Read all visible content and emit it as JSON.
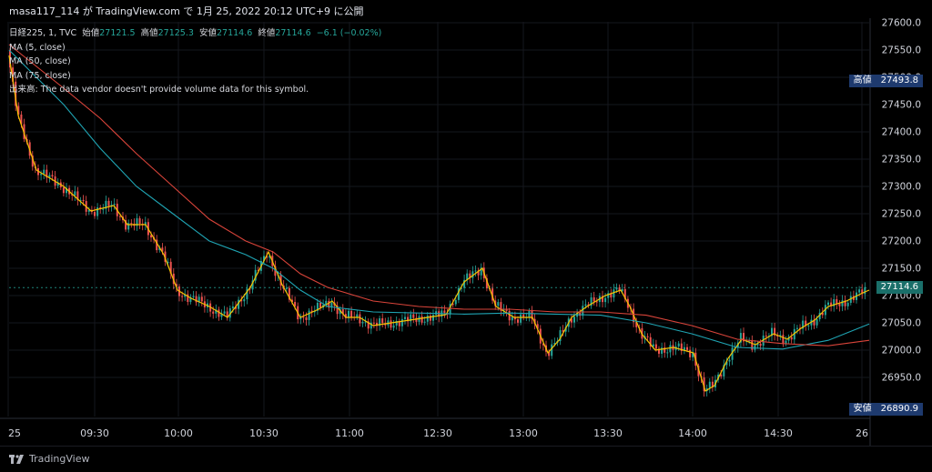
{
  "header": {
    "title": "masa117_114 が TradingView.com で 1月 25, 2022 20:12 UTC+9 に公開"
  },
  "legend": {
    "symbol": "日経225, 1, TVC",
    "open_label": "始値",
    "open_value": "27121.5",
    "high_label": "高値",
    "high_value": "27125.3",
    "low_label": "安値",
    "low_value": "27114.6",
    "close_label": "終値",
    "close_value": "27114.6",
    "change": "−6.1 (−0.02%)",
    "ma1": "MA (5, close)",
    "ma2": "MA (50, close)",
    "ma3": "MA (75, close)",
    "volume": "出来高: The data vendor doesn't provide volume data for this symbol."
  },
  "price_tags": {
    "high_label": "高値",
    "high_value": "27493.8",
    "low_label": "安値",
    "low_value": "26890.9",
    "last_value": "27114.6"
  },
  "footer": {
    "brand": "TradingView"
  },
  "colors": {
    "up": "#26a69a",
    "down": "#ef5350",
    "ma5": "#f5c400",
    "ma50": "#1fa4b3",
    "ma75": "#d9443a",
    "high_tag": "#1e3a6e",
    "low_tag": "#1e3a6e",
    "last_tag": "#1a6f6a"
  },
  "chart_data": {
    "type": "candlestick",
    "ylim": [
      26890,
      27600
    ],
    "yticks": [
      27600.0,
      27550.0,
      27500.0,
      27450.0,
      27400.0,
      27350.0,
      27300.0,
      27250.0,
      27200.0,
      27150.0,
      27100.0,
      27050.0,
      27000.0,
      26950.0
    ],
    "ytick_labels": [
      "27600.0",
      "27550.0",
      "27500.0",
      "27450.0",
      "27400.0",
      "27350.0",
      "27300.0",
      "27250.0",
      "27200.0",
      "27150.0",
      "27100.0",
      "27050.0",
      "27000.0",
      "26950.0"
    ],
    "xticks": [
      "25",
      "09:30",
      "10:00",
      "10:30",
      "11:00",
      "12:30",
      "13:00",
      "13:30",
      "14:00",
      "14:30",
      "26"
    ],
    "last_price": 27114.6,
    "high": 27493.8,
    "low": 26890.9,
    "series": [
      {
        "name": "MA (5, close)",
        "values": [
          [
            0,
            27540
          ],
          [
            10,
            27430
          ],
          [
            30,
            27330
          ],
          [
            60,
            27300
          ],
          [
            90,
            27255
          ],
          [
            115,
            27265
          ],
          [
            130,
            27230
          ],
          [
            150,
            27230
          ],
          [
            170,
            27175
          ],
          [
            185,
            27110
          ],
          [
            200,
            27095
          ],
          [
            220,
            27080
          ],
          [
            240,
            27060
          ],
          [
            265,
            27115
          ],
          [
            285,
            27180
          ],
          [
            300,
            27120
          ],
          [
            320,
            27060
          ],
          [
            340,
            27075
          ],
          [
            355,
            27090
          ],
          [
            370,
            27060
          ],
          [
            385,
            27060
          ],
          [
            400,
            27045
          ],
          [
            420,
            27050
          ],
          [
            440,
            27055
          ],
          [
            460,
            27060
          ],
          [
            480,
            27065
          ],
          [
            500,
            27125
          ],
          [
            520,
            27150
          ],
          [
            535,
            27080
          ],
          [
            555,
            27060
          ],
          [
            575,
            27060
          ],
          [
            592,
            26995
          ],
          [
            605,
            27020
          ],
          [
            618,
            27060
          ],
          [
            635,
            27080
          ],
          [
            655,
            27100
          ],
          [
            672,
            27110
          ],
          [
            682,
            27080
          ],
          [
            695,
            27030
          ],
          [
            710,
            27000
          ],
          [
            730,
            27005
          ],
          [
            752,
            26995
          ],
          [
            765,
            26925
          ],
          [
            775,
            26935
          ],
          [
            790,
            26985
          ],
          [
            805,
            27020
          ],
          [
            820,
            27010
          ],
          [
            840,
            27030
          ],
          [
            855,
            27020
          ],
          [
            870,
            27040
          ],
          [
            885,
            27055
          ],
          [
            900,
            27080
          ],
          [
            920,
            27090
          ],
          [
            938,
            27105
          ],
          [
            945,
            27110
          ]
        ]
      },
      {
        "name": "MA (50, close)",
        "values": [
          [
            0,
            27550
          ],
          [
            30,
            27500
          ],
          [
            60,
            27450
          ],
          [
            100,
            27370
          ],
          [
            140,
            27300
          ],
          [
            180,
            27250
          ],
          [
            220,
            27200
          ],
          [
            260,
            27175
          ],
          [
            290,
            27150
          ],
          [
            320,
            27110
          ],
          [
            350,
            27080
          ],
          [
            400,
            27070
          ],
          [
            450,
            27068
          ],
          [
            500,
            27066
          ],
          [
            550,
            27068
          ],
          [
            600,
            27066
          ],
          [
            650,
            27064
          ],
          [
            700,
            27050
          ],
          [
            750,
            27030
          ],
          [
            800,
            27005
          ],
          [
            850,
            27002
          ],
          [
            900,
            27018
          ],
          [
            945,
            27048
          ]
        ]
      },
      {
        "name": "MA (75, close)",
        "values": [
          [
            0,
            27560
          ],
          [
            30,
            27520
          ],
          [
            60,
            27480
          ],
          [
            100,
            27425
          ],
          [
            140,
            27360
          ],
          [
            180,
            27300
          ],
          [
            220,
            27240
          ],
          [
            260,
            27200
          ],
          [
            290,
            27180
          ],
          [
            320,
            27140
          ],
          [
            350,
            27115
          ],
          [
            400,
            27090
          ],
          [
            450,
            27080
          ],
          [
            500,
            27075
          ],
          [
            550,
            27075
          ],
          [
            600,
            27070
          ],
          [
            650,
            27070
          ],
          [
            700,
            27064
          ],
          [
            750,
            27045
          ],
          [
            800,
            27020
          ],
          [
            850,
            27012
          ],
          [
            900,
            27008
          ],
          [
            945,
            27018
          ]
        ]
      }
    ]
  }
}
